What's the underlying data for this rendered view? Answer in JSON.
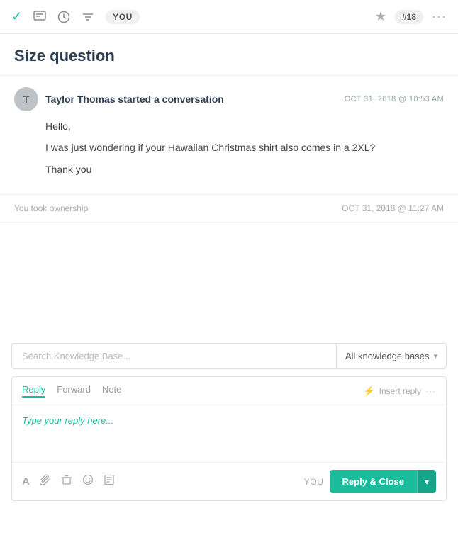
{
  "toolbar": {
    "icons": [
      {
        "name": "check-icon",
        "symbol": "✓",
        "active": true
      },
      {
        "name": "chat-icon",
        "symbol": "⬜",
        "active": false
      },
      {
        "name": "clock-icon",
        "symbol": "⏱",
        "active": false
      },
      {
        "name": "filter-icon",
        "symbol": "⌥",
        "active": false
      }
    ],
    "user_badge": "YOU",
    "ticket_number": "#18",
    "star_label": "★",
    "more_label": "···"
  },
  "page": {
    "title": "Size question"
  },
  "conversation": {
    "sender_initial": "T",
    "sender_name": "Taylor Thomas started a conversation",
    "timestamp": "OCT 31, 2018 @ 10:53 AM",
    "messages": [
      "Hello,",
      "I was just wondering if your Hawaiian Christmas shirt also comes in a 2XL?",
      "Thank you"
    ],
    "ownership_text": "You took ownership",
    "ownership_time": "OCT 31, 2018 @ 11:27 AM"
  },
  "knowledge_base": {
    "search_placeholder": "Search Knowledge Base...",
    "dropdown_label": "All knowledge bases",
    "chevron": "▾"
  },
  "reply_area": {
    "tabs": [
      {
        "label": "Reply",
        "active": true
      },
      {
        "label": "Forward",
        "active": false
      },
      {
        "label": "Note",
        "active": false
      }
    ],
    "insert_reply_label": "Insert reply",
    "lightning_icon": "⚡",
    "more_icon": "···",
    "placeholder": "Type your reply here..."
  },
  "bottom_toolbar": {
    "icons": [
      {
        "name": "text-format-icon",
        "symbol": "A"
      },
      {
        "name": "attachment-icon",
        "symbol": "📎"
      },
      {
        "name": "delete-icon",
        "symbol": "🗑"
      },
      {
        "name": "emoji-icon",
        "symbol": "☺"
      },
      {
        "name": "article-icon",
        "symbol": "⊟"
      }
    ],
    "you_label": "YOU",
    "reply_close_label": "Reply & Close",
    "chevron_down": "▾"
  }
}
